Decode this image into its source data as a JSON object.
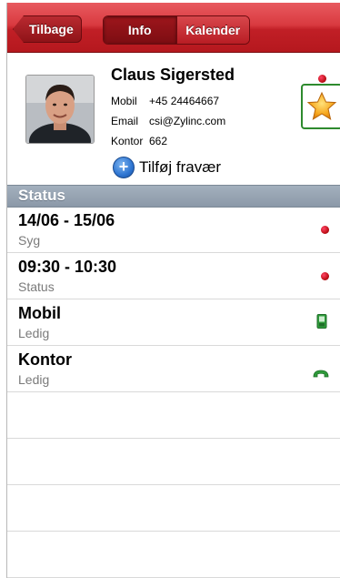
{
  "navbar": {
    "back_label": "Tilbage",
    "segments": [
      "Info",
      "Kalender"
    ]
  },
  "contact": {
    "name": "Claus Sigersted",
    "fields": [
      {
        "label": "Mobil",
        "value": "+45 24464667"
      },
      {
        "label": "Email",
        "value": "csi@Zylinc.com"
      },
      {
        "label": "Kontor",
        "value": "662"
      }
    ],
    "add_absence_label": "Tilføj fravær"
  },
  "status": {
    "header": "Status",
    "rows": [
      {
        "title": "14/06 - 15/06",
        "subtitle": "Syg",
        "indicator": "red-dot"
      },
      {
        "title": "09:30 - 10:30",
        "subtitle": "Status",
        "indicator": "red-dot"
      },
      {
        "title": "Mobil",
        "subtitle": "Ledig",
        "indicator": "mobile-phone-icon"
      },
      {
        "title": "Kontor",
        "subtitle": "Ledig",
        "indicator": "phone-handset-icon"
      }
    ]
  },
  "colors": {
    "navbar_red": "#c11f26",
    "section_gray": "#8b99a8",
    "available_green": "#2e9b3b",
    "favorite_border": "#2e8a2e"
  }
}
